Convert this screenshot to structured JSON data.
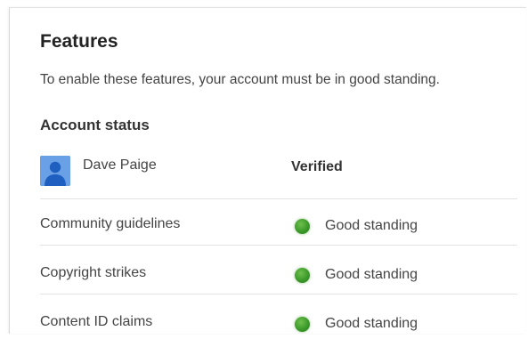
{
  "features": {
    "title": "Features",
    "description": "To enable these features, your account must be in good standing."
  },
  "account_status": {
    "heading": "Account status",
    "user": {
      "name": "Dave Paige",
      "status": "Verified"
    },
    "items": [
      {
        "label": "Community guidelines",
        "status": "Good standing"
      },
      {
        "label": "Copyright strikes",
        "status": "Good standing"
      },
      {
        "label": "Content ID claims",
        "status": "Good standing"
      }
    ]
  },
  "colors": {
    "status_good": "#3b9a2a",
    "avatar_bg": "#6aa0e6",
    "divider": "#e3e3e3"
  },
  "icons": {
    "avatar": "user-avatar-icon",
    "status": "green-status-dot-icon"
  }
}
